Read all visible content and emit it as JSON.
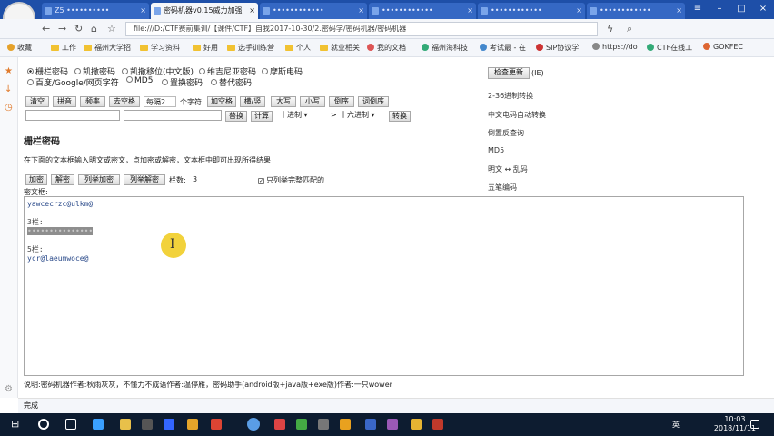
{
  "browser": {
    "tabs": [
      {
        "label": "Z5 ••••••••••"
      },
      {
        "label": "密码机器v0.15威力加强"
      },
      {
        "label": "••••••••••••"
      },
      {
        "label": "••••••••••••"
      },
      {
        "label": "••••••••••••"
      },
      {
        "label": "••••••••••••"
      }
    ],
    "url": "file:///D:/CTF赛前集训/【课件/CTF】自我2017-10-30/2.密码学/密码机器/密码机器",
    "bookmarks": [
      "收藏",
      "工作",
      "福州大学招",
      "学习资料",
      "好用",
      "选手训练营",
      "个人",
      "就业相关",
      "我的文档",
      "福州海科技",
      "考试最 - 在",
      "SIP协议学",
      "https://do",
      "CTF在线工",
      "GOKFEC"
    ]
  },
  "app": {
    "ciphers": [
      "栅栏密码",
      "凯撒密码",
      "凯撒移位(中文版)",
      "维吉尼亚密码",
      "摩斯电码",
      "百度/Google/网页字符",
      "MD5",
      "置换密码",
      "替代密码"
    ],
    "selected_cipher": "栅栏密码",
    "toolbar1": [
      "清空",
      "拼音",
      "频率",
      "去空格",
      "每隔2",
      "个字符",
      "加空格",
      "横/竖",
      "大写",
      "小写",
      "倒序",
      "词倒序"
    ],
    "toolbar2": {
      "swap": "替换",
      "calc": "计算",
      "from_base": "十进制",
      "arrow": ">",
      "to_base": "十六进制",
      "convert": "转换"
    },
    "title": "栅栏密码",
    "desc": "在下面的文本框输入明文或密文，点加密或解密，文本框中即可出现所得结果",
    "actions": {
      "encrypt": "加密",
      "decrypt": "解密",
      "list_encrypt": "列举加密",
      "list_decrypt": "列举解密",
      "rails_label": "栏数:",
      "rails_value": "3",
      "only_complete": "只列举完整匹配的"
    },
    "output_label": "密文框:",
    "output_lines": [
      "yawcecrzc@ulkm@",
      "",
      "3栏:",
      "•••••••••••••••",
      "",
      "5栏:",
      "ycr@laeumwoce@"
    ],
    "check_update": "检查更新",
    "check_update_suffix": "(IE)",
    "right_links": [
      "2-36进制转换",
      "中文电码自动转换",
      "倒置反查询",
      "MD5",
      "明文 ↔ 乱码",
      "五笔编码"
    ],
    "footer": "说明:密码机器作者:秋雨灰灰，不懂力不成语作者:温停雁，密码助手(android版+java版+exe版)作者:一只wower"
  },
  "status": {
    "text": "完成"
  },
  "taskbar": {
    "time": "10:03",
    "date": "2018/11/11",
    "lang": "英"
  }
}
